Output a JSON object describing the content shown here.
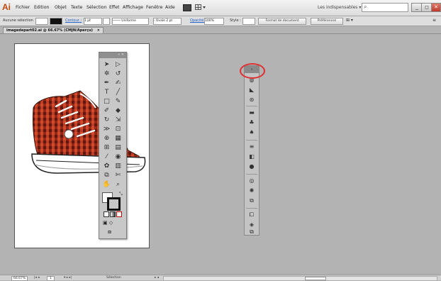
{
  "app": {
    "logo": "Ai"
  },
  "menu": [
    "Fichier",
    "Edition",
    "Objet",
    "Texte",
    "Sélection",
    "Effet",
    "Affichage",
    "Fenêtre",
    "Aide"
  ],
  "workspace": "Les indispensables",
  "window_buttons": [
    "_",
    "◻",
    "✕"
  ],
  "controlbar": {
    "selection": "Aucune sélection",
    "stroke_label": "Contour :",
    "stroke_weight": "1 pt",
    "stroke_profile": "Uniforme",
    "brush": "Ovale 2 pt",
    "opacity_label": "Opacité :",
    "opacity": "100%",
    "style_label": "Style :",
    "doc_format": "Format de document",
    "prefs": "Préférences"
  },
  "tab": {
    "title": "imagedepart02.ai @ 66.67% (CMJN/Aperçu)",
    "close": "×"
  },
  "status": {
    "zoom": "66.67%",
    "page": "1",
    "tool": "Sélection"
  },
  "tools": [
    "selection-arrow",
    "direct-selection",
    "magic-wand",
    "lasso",
    "pen",
    "curvature",
    "type",
    "line",
    "rectangle",
    "paintbrush",
    "pencil",
    "eraser",
    "rotate",
    "scale",
    "width",
    "free-transform",
    "shape-builder",
    "perspective",
    "mesh",
    "gradient",
    "eyedropper",
    "blend",
    "symbol-sprayer",
    "column-graph",
    "artboard",
    "slice",
    "hand",
    "zoom"
  ],
  "dock_icons": [
    "color",
    "color-guide",
    "swatches",
    "brushes",
    "symbols",
    "graphic-styles",
    "stroke",
    "gradient",
    "transparency",
    "appearance",
    "layers-panel",
    "artboards",
    "links",
    "layers",
    "align"
  ]
}
